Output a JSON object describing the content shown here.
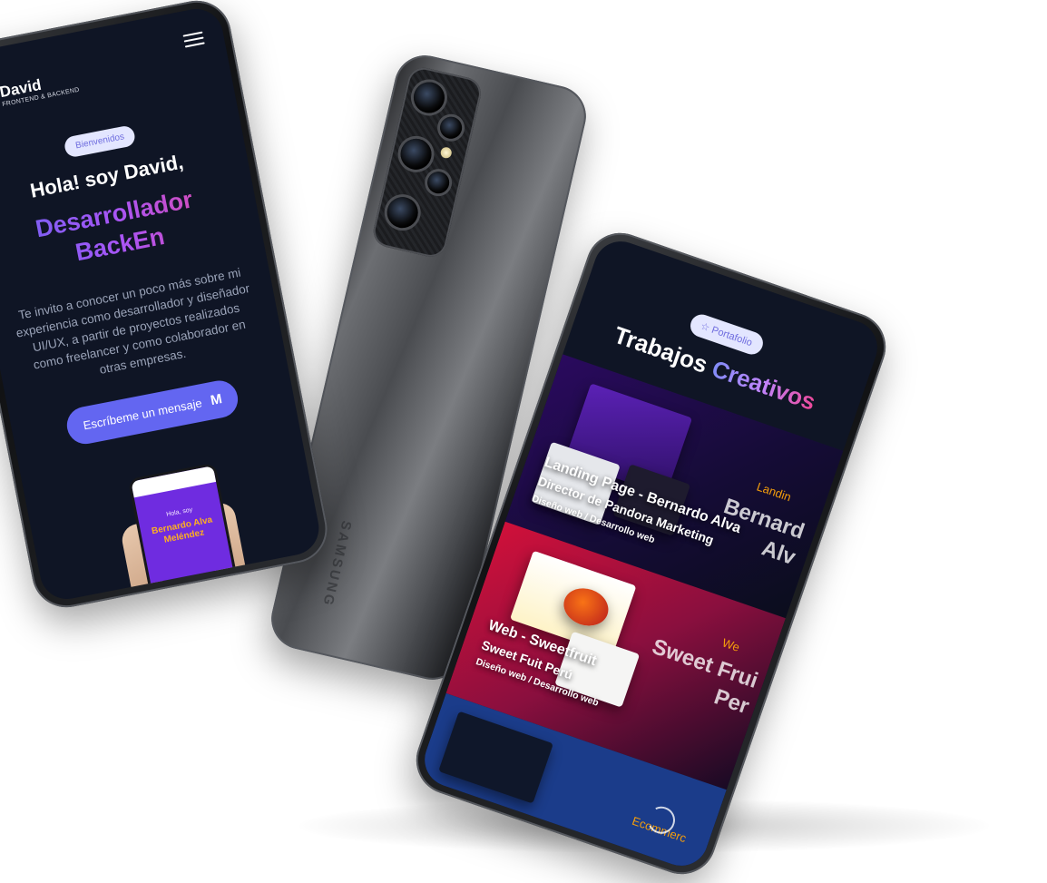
{
  "left_phone": {
    "brand_name": "David",
    "brand_tagline": "FRONTEND & BACKEND",
    "welcome_badge": "Bienvenidos",
    "greeting": "Hola! soy David,",
    "role_line_1": "Desarrollador",
    "role_line_2": "BackEn",
    "intro": "Te invito a conocer un poco más sobre mi experiencia como desarrollador y diseñador UI/UX, a partir de proyectos realizados como freelancer y como colaborador en otras empresas.",
    "cta_label": "Escríbeme un mensaje",
    "cta_icon": "gmail-icon",
    "mini_phone": {
      "hello": "Hola, soy",
      "name": "Bernardo Alva Meléndez"
    }
  },
  "back_phone": {
    "brand": "SAMSUNG"
  },
  "right_phone": {
    "section_badge": "Portafolio",
    "section_badge_icon": "star-icon",
    "title_plain": "Trabajos",
    "title_accent": "Creativos",
    "projects": [
      {
        "title": "Landing Page - Bernardo Alva",
        "subtitle": "Director de Pandora Marketing",
        "tags": "Diseño web / Desarrollo web",
        "side_tag": "Landin",
        "side_title": "Bernard Alv"
      },
      {
        "title": "Web - Sweetfruit",
        "subtitle": "Sweet Fuit Perú",
        "tags": "Diseño web / Desarrollo web",
        "side_tag": "We",
        "side_title": "Sweet Frui Per"
      },
      {
        "side_tag": "Ecommerc"
      }
    ]
  },
  "colors": {
    "screen_bg": "#0f1525",
    "accent_indigo": "#6366f1",
    "accent_pink": "#ec4899",
    "badge_bg": "#e3e6ff",
    "side_tag": "#f59e0b"
  }
}
